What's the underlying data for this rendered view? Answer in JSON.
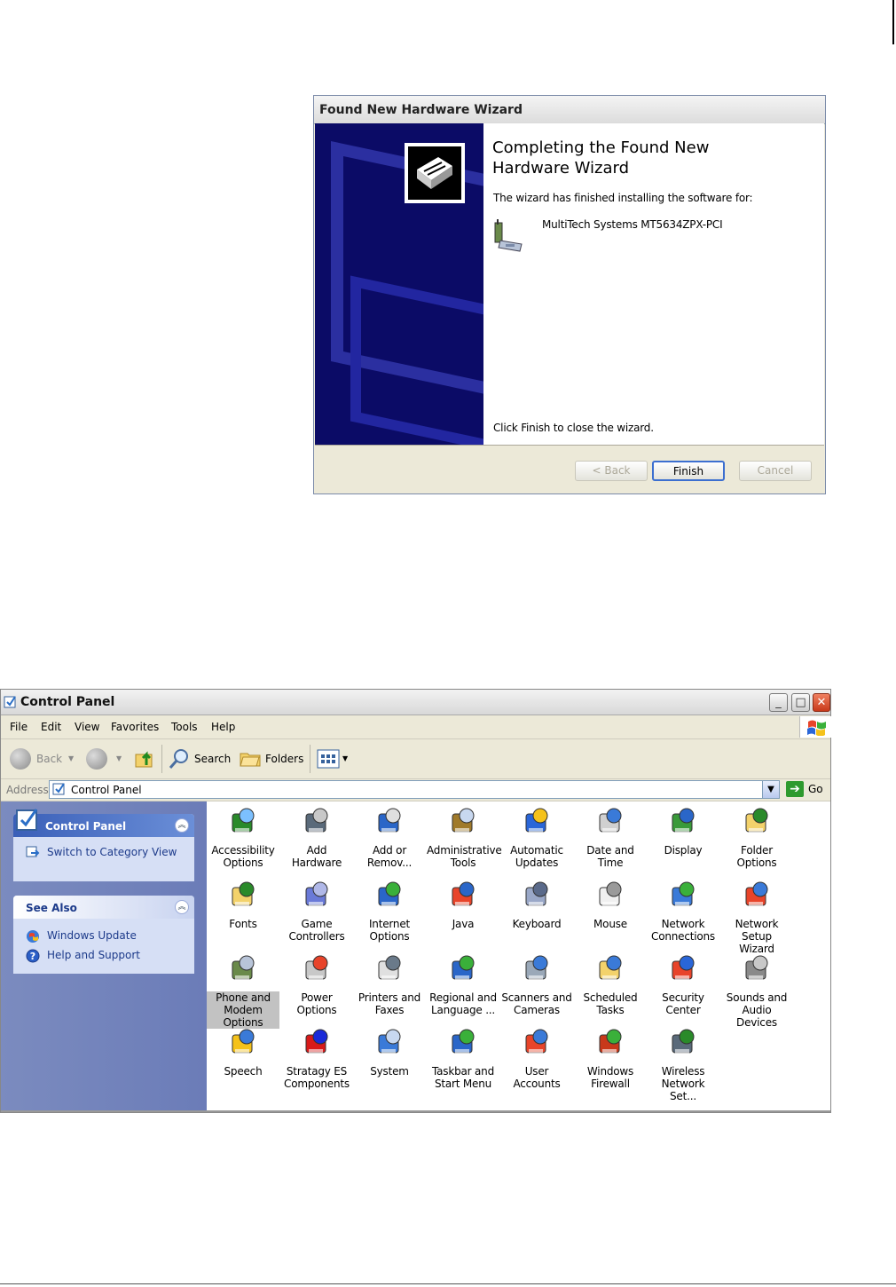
{
  "wizard": {
    "title": "Found New Hardware Wizard",
    "heading_line1": "Completing the Found New",
    "heading_line2": "Hardware Wizard",
    "finished_text": "The wizard has finished installing the software for:",
    "device_name": "MultiTech Systems MT5634ZPX-PCI",
    "close_text": "Click Finish to close the wizard.",
    "back_label": "< Back",
    "finish_label": "Finish",
    "cancel_label": "Cancel"
  },
  "control_panel": {
    "title": "Control Panel",
    "menu": [
      "File",
      "Edit",
      "View",
      "Favorites",
      "Tools",
      "Help"
    ],
    "toolbar": {
      "back": "Back",
      "search": "Search",
      "folders": "Folders"
    },
    "address_label": "Address",
    "address_value": "Control Panel",
    "go_label": "Go",
    "left_panel": {
      "header": "Control Panel",
      "switch_view": "Switch to Category View",
      "see_also_header": "See Also",
      "see_also": [
        "Windows Update",
        "Help and Support"
      ]
    },
    "items": [
      {
        "l1": "Accessibility",
        "l2": "Options",
        "l3": ""
      },
      {
        "l1": "Add Hardware",
        "l2": "",
        "l3": ""
      },
      {
        "l1": "Add or",
        "l2": "Remov...",
        "l3": ""
      },
      {
        "l1": "Administrative",
        "l2": "Tools",
        "l3": ""
      },
      {
        "l1": "Automatic",
        "l2": "Updates",
        "l3": ""
      },
      {
        "l1": "Date and Time",
        "l2": "",
        "l3": ""
      },
      {
        "l1": "Display",
        "l2": "",
        "l3": ""
      },
      {
        "l1": "Folder Options",
        "l2": "",
        "l3": ""
      },
      {
        "l1": "Fonts",
        "l2": "",
        "l3": ""
      },
      {
        "l1": "Game",
        "l2": "Controllers",
        "l3": ""
      },
      {
        "l1": "Internet",
        "l2": "Options",
        "l3": ""
      },
      {
        "l1": "Java",
        "l2": "",
        "l3": ""
      },
      {
        "l1": "Keyboard",
        "l2": "",
        "l3": ""
      },
      {
        "l1": "Mouse",
        "l2": "",
        "l3": ""
      },
      {
        "l1": "Network",
        "l2": "Connections",
        "l3": ""
      },
      {
        "l1": "Network Setup",
        "l2": "Wizard",
        "l3": ""
      },
      {
        "l1": "Phone and",
        "l2": "Modem",
        "l3": "Options"
      },
      {
        "l1": "Power Options",
        "l2": "",
        "l3": ""
      },
      {
        "l1": "Printers and",
        "l2": "Faxes",
        "l3": ""
      },
      {
        "l1": "Regional and",
        "l2": "Language ...",
        "l3": ""
      },
      {
        "l1": "Scanners and",
        "l2": "Cameras",
        "l3": ""
      },
      {
        "l1": "Scheduled",
        "l2": "Tasks",
        "l3": ""
      },
      {
        "l1": "Security",
        "l2": "Center",
        "l3": ""
      },
      {
        "l1": "Sounds and",
        "l2": "Audio Devices",
        "l3": ""
      },
      {
        "l1": "Speech",
        "l2": "",
        "l3": ""
      },
      {
        "l1": "Stratagy ES",
        "l2": "Components",
        "l3": ""
      },
      {
        "l1": "System",
        "l2": "",
        "l3": ""
      },
      {
        "l1": "Taskbar and",
        "l2": "Start Menu",
        "l3": ""
      },
      {
        "l1": "User Accounts",
        "l2": "",
        "l3": ""
      },
      {
        "l1": "Windows",
        "l2": "Firewall",
        "l3": ""
      },
      {
        "l1": "Wireless",
        "l2": "Network Set...",
        "l3": ""
      }
    ],
    "selected_item": "Phone and Modem Options",
    "colors": {
      "left_pane": "#6b7cb8",
      "selection": "#c2c2c2",
      "wizard_side": "#0b0b66"
    }
  }
}
